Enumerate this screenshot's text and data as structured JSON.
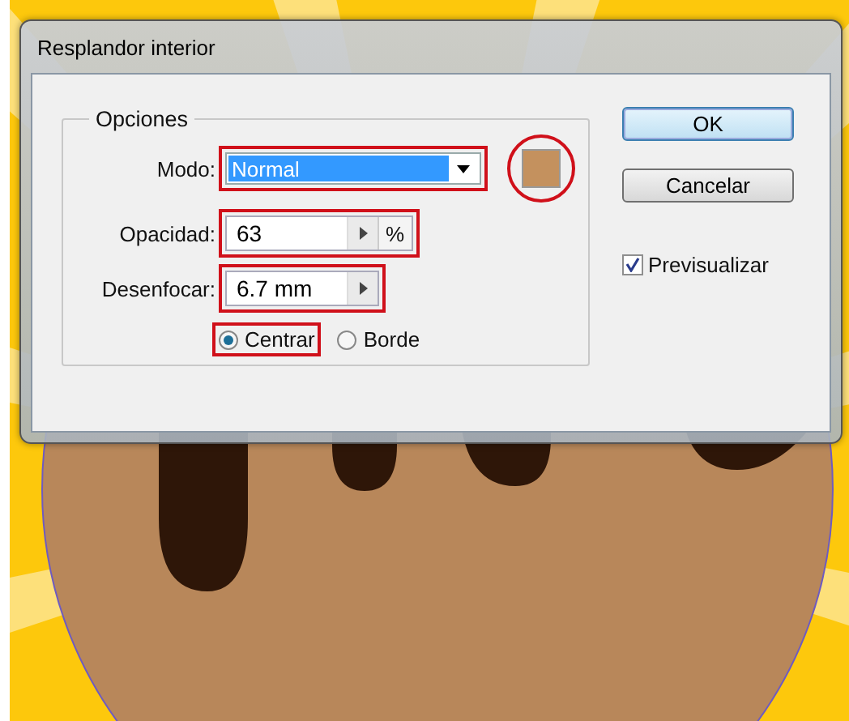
{
  "window": {
    "title": "Resplandor interior"
  },
  "options": {
    "legend": "Opciones",
    "mode": {
      "label": "Modo:",
      "value": "Normal",
      "highlighted": true
    },
    "color_swatch": {
      "color": "#c4915e",
      "highlighted": true
    },
    "opacity": {
      "label": "Opacidad:",
      "value": "63",
      "unit": "%",
      "highlighted": true
    },
    "blur": {
      "label": "Desenfocar:",
      "value": "6.7 mm",
      "highlighted": true
    },
    "radios": [
      {
        "label": "Centrar",
        "selected": true,
        "highlighted": true
      },
      {
        "label": "Borde",
        "selected": false,
        "highlighted": false
      }
    ]
  },
  "buttons": [
    {
      "label": "OK",
      "default": true
    },
    {
      "label": "Cancelar",
      "default": false
    }
  ],
  "preview": {
    "label": "Previsualizar",
    "checked": true
  }
}
